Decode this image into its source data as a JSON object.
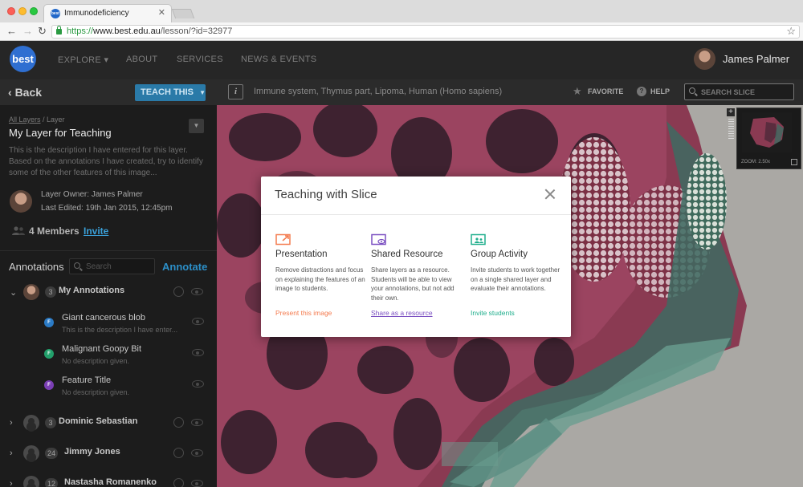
{
  "browser": {
    "tab_title": "Immunodeficiency",
    "tab_favicon": "best",
    "url_protocol": "https://",
    "url_host": "www.best.edu.au",
    "url_path": "/lesson/?id=32977"
  },
  "header": {
    "logo": "best",
    "nav": [
      "EXPLORE",
      "ABOUT",
      "SERVICES",
      "NEWS & EVENTS"
    ],
    "user_name": "James Palmer"
  },
  "sidebar": {
    "back_label": "Back",
    "teach_label": "TEACH THIS",
    "breadcrumb_link": "All Layers",
    "breadcrumb_sep": " / ",
    "breadcrumb_current": "Layer",
    "layer_title": "My Layer for Teaching",
    "layer_description": "This is the description I have entered for this layer. Based on the annotations I have created, try to identify some of the other features of this image...",
    "owner_label": "Layer Owner:",
    "owner_name": "James Palmer",
    "edited_label": "Last Edited:",
    "edited_value": "19th Jan 2015, 12:45pm",
    "members_text": "4 Members",
    "invite_label": "Invite",
    "annotations_heading": "Annotations",
    "search_placeholder": "Search",
    "annotate_label": "Annotate",
    "groups": [
      {
        "count": "3",
        "name": "My Annotations"
      },
      {
        "count": "3",
        "name": "Dominic Sebastian"
      },
      {
        "count": "24",
        "name": "Jimmy Jones"
      },
      {
        "count": "12",
        "name": "Nastasha Romanenko"
      }
    ],
    "annotations": [
      {
        "badge": "F",
        "title": "Giant cancerous blob",
        "description": "This is the description I have enter...",
        "color": "#2b7bc6"
      },
      {
        "badge": "F",
        "title": "Malignant Goopy Bit",
        "description": "No description given.",
        "color": "#22a06b"
      },
      {
        "badge": "F",
        "title": "Feature Title",
        "description": "No description given.",
        "color": "#7b3fb5"
      }
    ]
  },
  "viewer": {
    "info_label": "i",
    "slide_title": "Immune system, Thymus part, Lipoma, Human (Homo sapiens)",
    "favorite_label": "FAVORITE",
    "help_label": "HELP",
    "search_placeholder": "SEARCH SLICE",
    "zoom_label": "ZOOM: 2.50x"
  },
  "modal": {
    "title": "Teaching with Slice",
    "options": [
      {
        "title": "Presentation",
        "description": "Remove distractions and focus on explaining the features of an image to students.",
        "link": "Present this image",
        "color": "#f47b4f"
      },
      {
        "title": "Shared Resource",
        "description": "Share layers as a resource. Students will be able to view your annotations, but not add their own.",
        "link": "Share as a resource",
        "color": "#7a4fc1"
      },
      {
        "title": "Group Activity",
        "description": "Invite students to work together on a single shared layer and evaluate their annotations.",
        "link": "Invite students",
        "color": "#1fae8c"
      }
    ]
  }
}
